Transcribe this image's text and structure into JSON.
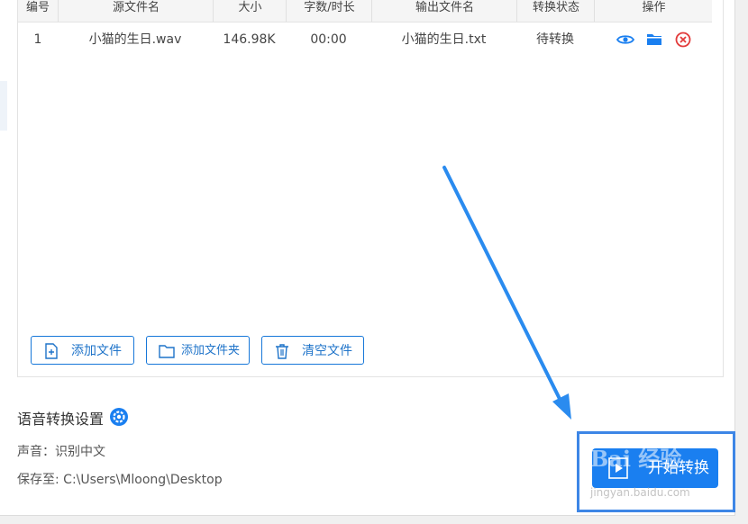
{
  "table": {
    "headers": [
      "编号",
      "源文件名",
      "大小",
      "字数/时长",
      "输出文件名",
      "转换状态",
      "操作"
    ],
    "rows": [
      {
        "index": "1",
        "source": "小猫的生日.wav",
        "size": "146.98K",
        "duration": "00:00",
        "output": "小猫的生日.txt",
        "status": "待转换"
      }
    ]
  },
  "buttons": {
    "add_file": "添加文件",
    "add_folder": "添加文件夹",
    "clear_files": "清空文件"
  },
  "settings": {
    "title": "语音转换设置",
    "voice_line": "声音：识别中文",
    "save_line": "保存至: C:\\Users\\Mloong\\Desktop"
  },
  "start": {
    "label": "开始转换"
  },
  "watermark": {
    "main": "Bai 经验",
    "sub": "jingyan.baidu.com"
  },
  "colors": {
    "accent": "#1a7ff0",
    "danger": "#e23b3b",
    "arrow": "#2a8bef"
  },
  "icons": {
    "view": "eye-icon",
    "open": "folder-icon",
    "delete": "close-circle-icon",
    "gear": "gear-icon"
  }
}
